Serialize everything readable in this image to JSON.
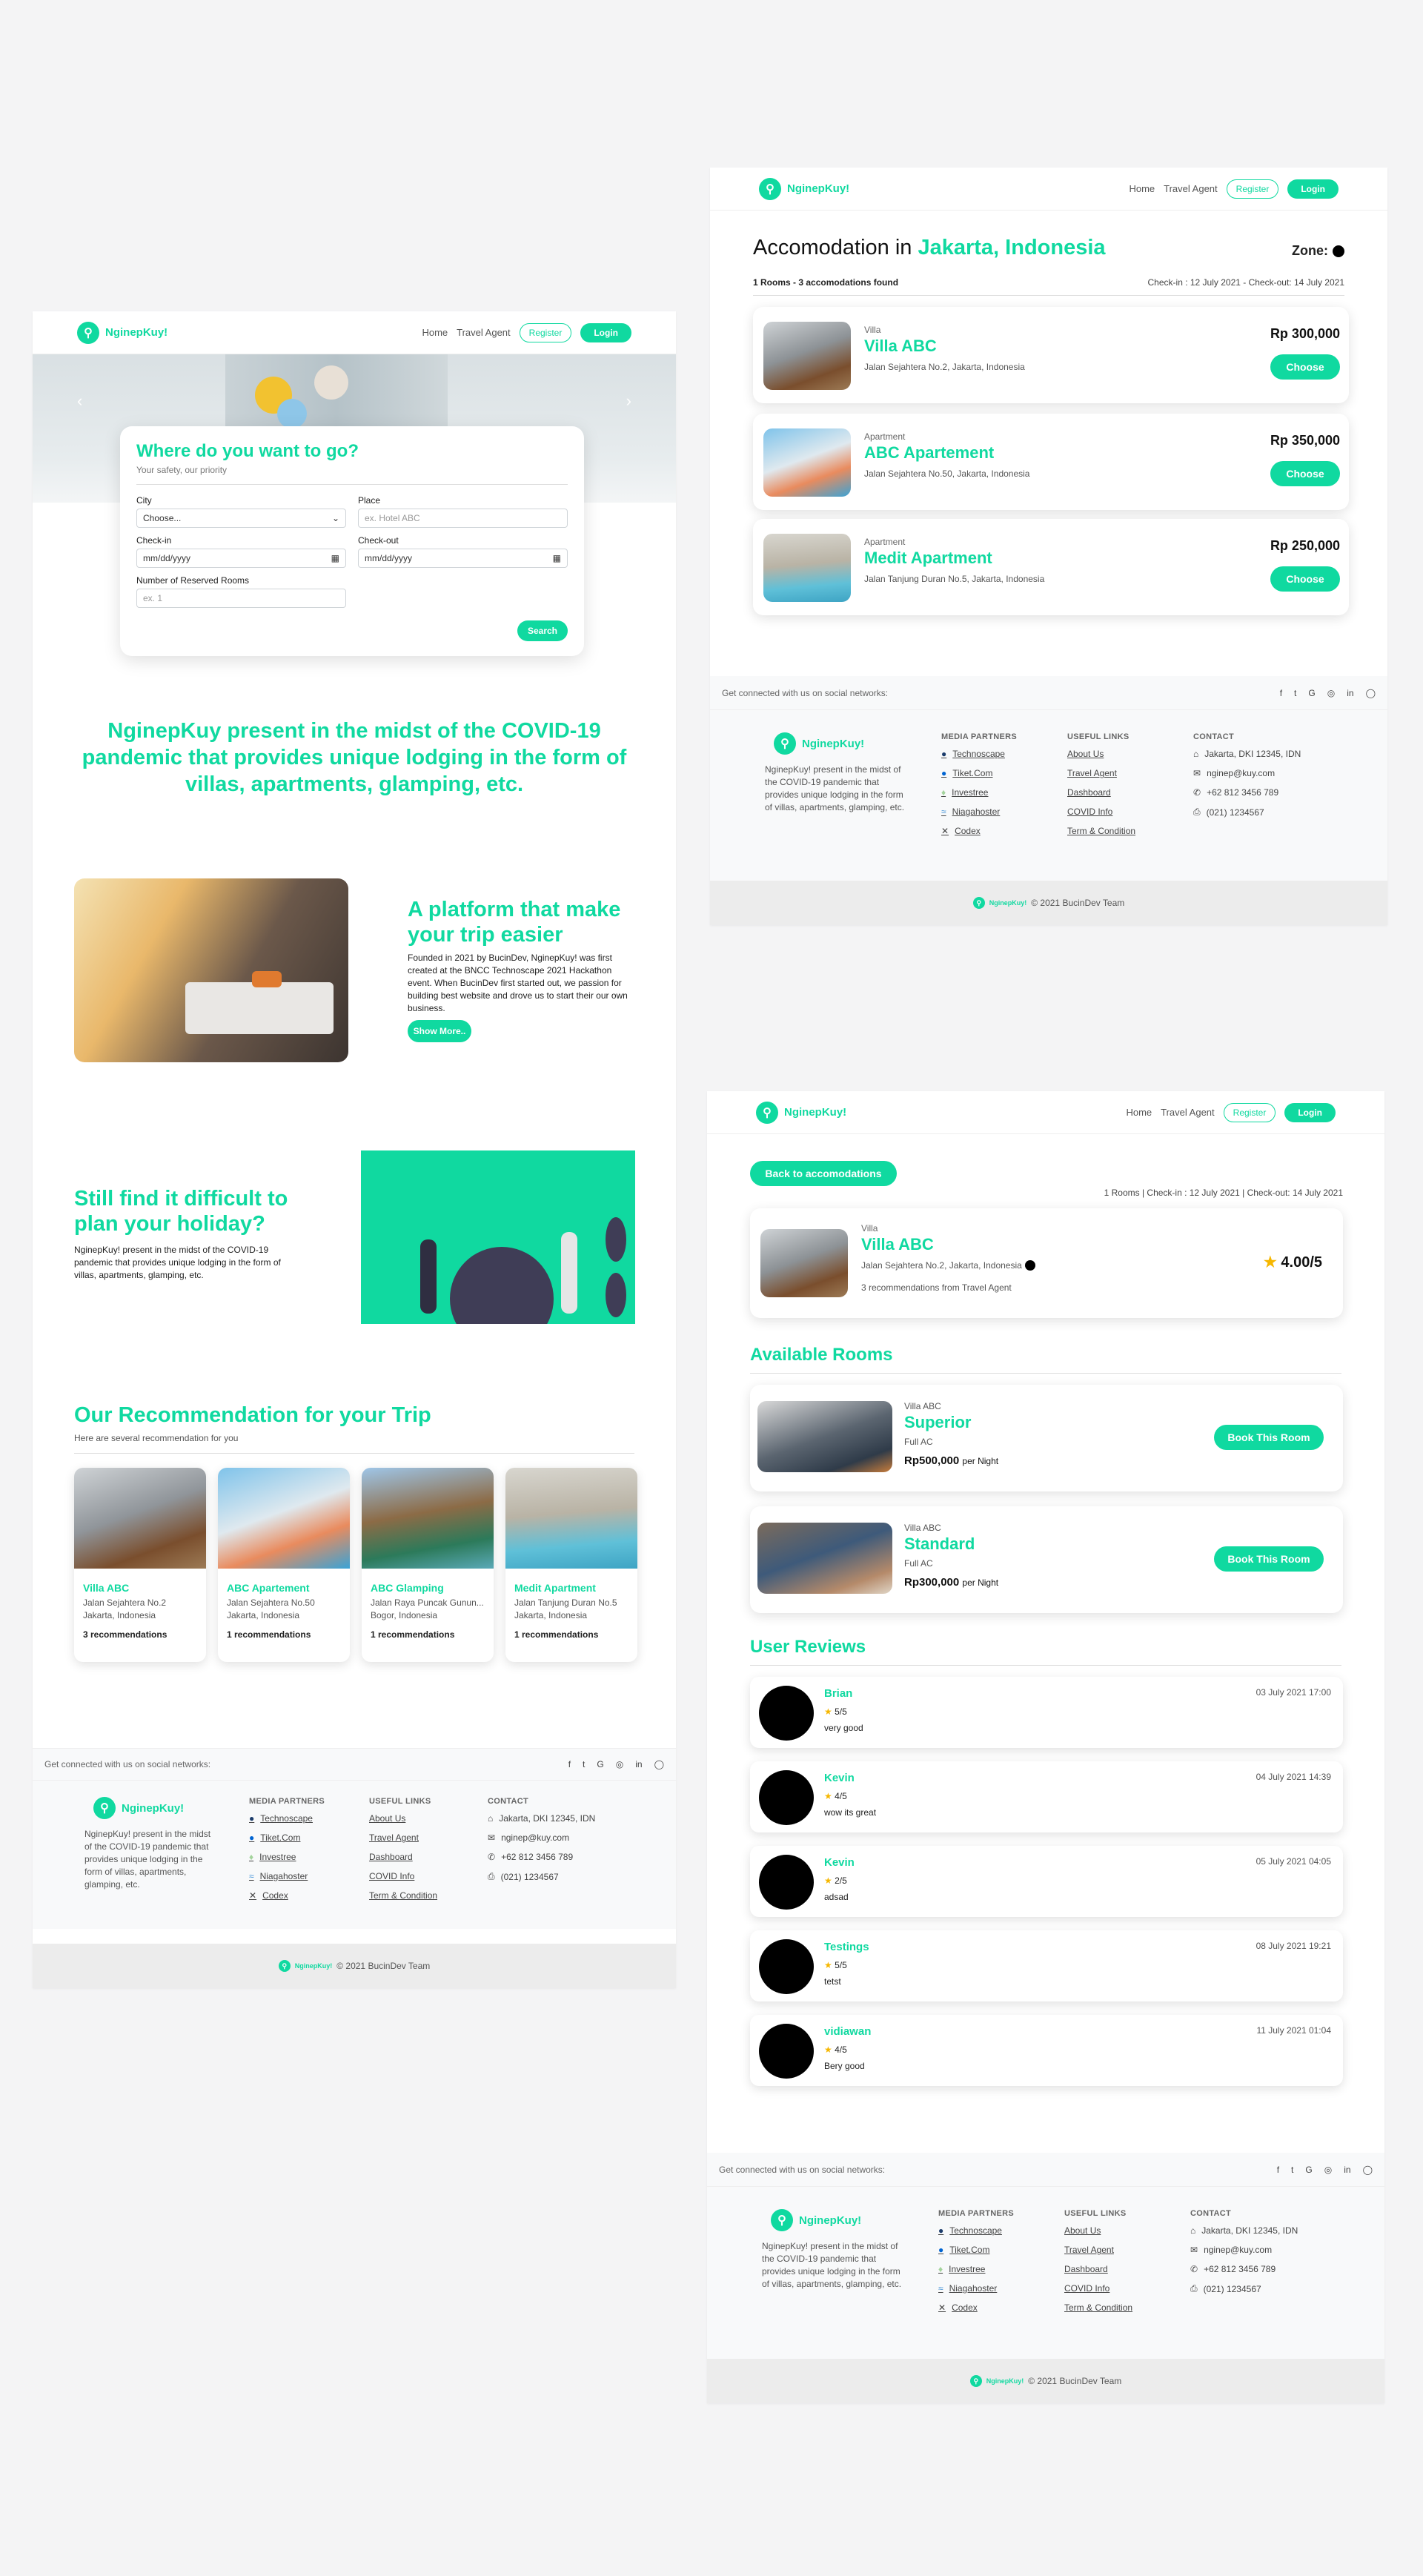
{
  "brand": {
    "name": "NginepKuy!",
    "accent": "#10d9a0"
  },
  "nav": {
    "home": "Home",
    "travel_agent": "Travel Agent",
    "register": "Register",
    "login": "Login"
  },
  "search": {
    "title": "Where do you want to go?",
    "subtitle": "Your safety, our priority",
    "city_label": "City",
    "city_value": "Choose...",
    "place_label": "Place",
    "place_placeholder": "ex. Hotel ABC",
    "checkin_label": "Check-in",
    "checkin_value": "mm/dd/yyyy",
    "checkout_label": "Check-out",
    "checkout_value": "mm/dd/yyyy",
    "rooms_label": "Number of Reserved Rooms",
    "rooms_placeholder": "ex. 1",
    "submit": "Search"
  },
  "covid_heading": "NginepKuy present in the midst of the COVID-19 pandemic that provides unique lodging in the form of villas, apartments, glamping, etc.",
  "platform": {
    "title": "A platform that make your trip easier",
    "body": "Founded in 2021 by BucinDev, NginepKuy! was first created at the BNCC Technoscape 2021 Hackathon event. When BucinDev first started out, we passion for building best website and drove us to start their our own business.",
    "button": "Show More.."
  },
  "difficult": {
    "title": "Still find it difficult to plan your holiday?",
    "body": "NginepKuy! present in the midst of the COVID-19 pandemic that provides unique lodging in the form of villas, apartments, glamping, etc."
  },
  "recommendation": {
    "title": "Our Recommendation for your Trip",
    "subtitle": "Here are several recommendation for you",
    "items": [
      {
        "name": "Villa ABC",
        "addr1": "Jalan Sejahtera No.2",
        "addr2": "Jakarta, Indonesia",
        "count": "3 recommendations"
      },
      {
        "name": "ABC Apartement",
        "addr1": "Jalan Sejahtera No.50",
        "addr2": "Jakarta, Indonesia",
        "count": "1 recommendations"
      },
      {
        "name": "ABC Glamping",
        "addr1": "Jalan Raya Puncak Gunun...",
        "addr2": "Bogor, Indonesia",
        "count": "1 recommendations"
      },
      {
        "name": "Medit Apartment",
        "addr1": "Jalan Tanjung Duran No.5",
        "addr2": "Jakarta, Indonesia",
        "count": "1 recommendations"
      }
    ]
  },
  "footer": {
    "social_text": "Get connected with us on social networks:",
    "social_icons": [
      "f",
      "t",
      "G",
      "◎",
      "in",
      "◯"
    ],
    "about": "NginepKuy! present in the midst of the COVID-19 pandemic that provides unique lodging in the form of villas, apartments, glamping, etc.",
    "media_title": "MEDIA PARTNERS",
    "media": [
      "Technoscape",
      "Tiket.Com",
      "Investree",
      "Niagahoster",
      "Codex"
    ],
    "links_title": "USEFUL LINKS",
    "links": [
      "About Us",
      "Travel Agent",
      "Dashboard",
      "COVID Info",
      "Term & Condition"
    ],
    "contact_title": "CONTACT",
    "contact": [
      "Jakarta, DKI 12345, IDN",
      "nginep@kuy.com",
      "+62 812 3456 789",
      "(021) 1234567"
    ],
    "copyright": "© 2021 BucinDev Team"
  },
  "accomodation": {
    "title_prefix": "Accomodation in ",
    "title_city": "Jakarta, Indonesia",
    "zone_label": "Zone:",
    "summary": "1 Rooms - 3 accomodations found",
    "dates": "Check-in : 12 July 2021 - Check-out: 14 July 2021",
    "choose": "Choose",
    "items": [
      {
        "type": "Villa",
        "name": "Villa ABC",
        "addr": "Jalan Sejahtera No.2, Jakarta, Indonesia",
        "price": "Rp 300,000"
      },
      {
        "type": "Apartment",
        "name": "ABC Apartement",
        "addr": "Jalan Sejahtera No.50, Jakarta, Indonesia",
        "price": "Rp 350,000"
      },
      {
        "type": "Apartment",
        "name": "Medit Apartment",
        "addr": "Jalan Tanjung Duran No.5, Jakarta, Indonesia",
        "price": "Rp 250,000"
      }
    ]
  },
  "detail": {
    "back": "Back to accomodations",
    "info": "1 Rooms | Check-in : 12 July 2021 | Check-out: 14 July 2021",
    "type": "Villa",
    "name": "Villa ABC",
    "addr": "Jalan Sejahtera No.2, Jakarta, Indonesia",
    "recs": "3 recommendations from Travel Agent",
    "rating": "4.00/5",
    "rooms_title": "Available Rooms",
    "book": "Book This Room",
    "rooms": [
      {
        "villa": "Villa ABC",
        "name": "Superior",
        "facility": "Full AC",
        "price": "Rp500,000",
        "unit": "per Night"
      },
      {
        "villa": "Villa ABC",
        "name": "Standard",
        "facility": "Full AC",
        "price": "Rp300,000",
        "unit": "per Night"
      }
    ],
    "reviews_title": "User Reviews",
    "reviews": [
      {
        "name": "Brian",
        "score": "5/5",
        "text": "very good",
        "date": "03 July 2021 17:00"
      },
      {
        "name": "Kevin",
        "score": "4/5",
        "text": "wow its great",
        "date": "04 July 2021 14:39"
      },
      {
        "name": "Kevin",
        "score": "2/5",
        "text": "adsad",
        "date": "05 July 2021 04:05"
      },
      {
        "name": "Testings",
        "score": "5/5",
        "text": "tetst",
        "date": "08 July 2021 19:21"
      },
      {
        "name": "vidiawan",
        "score": "4/5",
        "text": "Bery good",
        "date": "11 July 2021 01:04"
      }
    ]
  }
}
